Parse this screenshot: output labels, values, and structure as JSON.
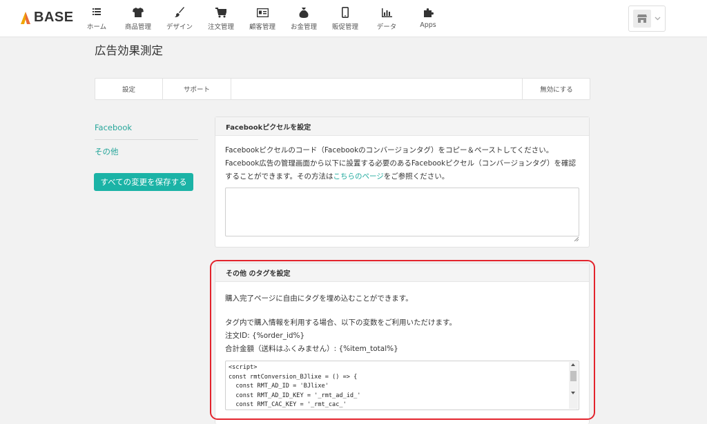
{
  "logo": {
    "text": "BASE",
    "icon": "tent-logo-icon"
  },
  "nav": [
    {
      "label": "ホーム",
      "icon": "list-icon"
    },
    {
      "label": "商品管理",
      "icon": "tshirt-icon"
    },
    {
      "label": "デザイン",
      "icon": "brush-icon"
    },
    {
      "label": "注文管理",
      "icon": "cart-icon"
    },
    {
      "label": "顧客管理",
      "icon": "id-card-icon"
    },
    {
      "label": "お金管理",
      "icon": "money-bag-icon"
    },
    {
      "label": "販促管理",
      "icon": "smartphone-icon"
    },
    {
      "label": "データ",
      "icon": "bar-chart-icon"
    },
    {
      "label": "Apps",
      "icon": "puzzle-icon"
    }
  ],
  "store_menu": {
    "icon": "store-icon"
  },
  "page": {
    "title": "広告効果測定"
  },
  "tabs": {
    "settings": "設定",
    "support": "サポート",
    "disable": "無効にする"
  },
  "sidebar": {
    "facebook": "Facebook",
    "other": "その他",
    "save_button": "すべての変更を保存する"
  },
  "facebook_panel": {
    "heading": "Facebookピクセルを設定",
    "line1": "Facebookピクセルのコード（Facebookのコンバージョンタグ）をコピー＆ペーストしてください。",
    "line2": "Facebook広告の管理画面から以下に設置する必要のあるFacebookピクセル（コンバージョンタグ）を確認",
    "line3_pre": "することができます。その方法は",
    "line3_link": "こちらのページ",
    "line3_post": "をご参照ください。",
    "pixel_code": ""
  },
  "other_panel": {
    "heading": "その他 のタグを設定",
    "intro": "購入完了ページに自由にタグを埋め込むことができます。",
    "vars_intro": "タグ内で購入情報を利用する場合、以下の変数をご利用いただけます。",
    "var_order": "注文ID: {%order_id%}",
    "var_total": "合計金額（送料はふくみません）: {%item_total%}",
    "code": "<script>\nconst rmtConversion_BJlixe = () => {\n  const RMT_AD_ID = 'BJlixe'\n  const RMT_AD_ID_KEY = '_rmt_ad_id_'\n  const RMT_CAC_KEY = '_rmt_cac_'"
  },
  "colors": {
    "accent": "#1bb3a6",
    "link": "#26a69a",
    "highlight": "#e3232c"
  }
}
